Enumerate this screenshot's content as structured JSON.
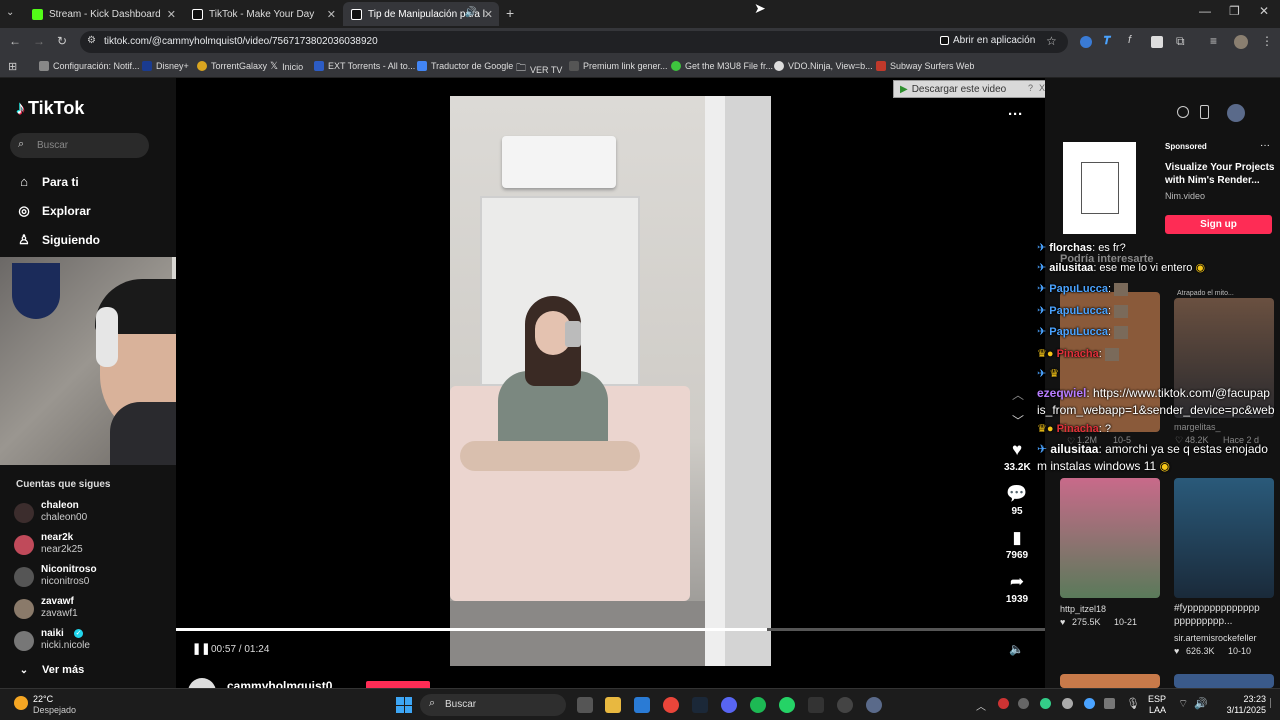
{
  "browser": {
    "tabs": [
      {
        "title": "Stream - Kick Dashboard",
        "active": false
      },
      {
        "title": "TikTok - Make Your Day",
        "active": false
      },
      {
        "title": "Tip de Manipulación para l",
        "active": true
      }
    ],
    "url": "tiktok.com/@cammyholmquist0/video/7567173802036038920",
    "open_in_app": "Abrir en aplicación",
    "bookmarks": [
      "Configuración: Notif...",
      "Disney+",
      "TorrentGalaxy",
      "Inicio",
      "EXT Torrents - All to...",
      "Traductor de Google",
      "VER TV",
      "Premium link gener...",
      "Get the M3U8 File fr...",
      "VDO.Ninja, View=b...",
      "Subway Surfers Web"
    ]
  },
  "download_bar": {
    "label": "Descargar este video",
    "help": "?",
    "close": "X"
  },
  "tiktok": {
    "logo": "TikTok",
    "search_placeholder": "Buscar",
    "nav": [
      "Para ti",
      "Explorar",
      "Siguiendo"
    ],
    "following_title": "Cuentas que sigues",
    "accounts": [
      {
        "name": "chaleon",
        "handle": "chaleon00"
      },
      {
        "name": "near2k",
        "handle": "near2k25"
      },
      {
        "name": "Niconitroso",
        "handle": "niconitros0"
      },
      {
        "name": "zavawf",
        "handle": "zavawf1"
      },
      {
        "name": "naiki",
        "handle": "nicki.nicole"
      }
    ],
    "see_more": "Ver más",
    "video": {
      "time": "00:57 / 01:24",
      "progress": 0.68,
      "author": "cammyholmquist0",
      "likes": "33.2K",
      "comments": "95",
      "saves": "7969",
      "shares": "1939"
    },
    "sponsored": {
      "label": "Sponsored",
      "title": "Visualize Your Projects with Nim's Render...",
      "domain": "Nim.video",
      "cta": "Sign up"
    },
    "might_like": "Podría interesarte",
    "related": [
      {
        "caption": "Atrapado el mito...",
        "user": "margelitas_",
        "views": "48.2K",
        "date": "Hace 2 d"
      },
      {
        "user": "",
        "views": "1.2M",
        "date": "10-5"
      },
      {
        "user": "http_itzel18",
        "views": "275.5K",
        "date": "10-21"
      },
      {
        "caption": "#fyppppppppppppp ppppppppp...",
        "user": "sir.artemisrockefeller",
        "views": "626.3K",
        "date": "10-10"
      }
    ]
  },
  "chat": [
    {
      "user": "florchas",
      "msg": ": es fr?",
      "color": "#ffffff"
    },
    {
      "user": "ailusitaa",
      "msg": ": ese me lo vi entero",
      "color": "#ffffff"
    },
    {
      "user": "PapuLucca",
      "msg": ":",
      "color": "#4aa3ff"
    },
    {
      "user": "PapuLucca",
      "msg": ":",
      "color": "#4aa3ff"
    },
    {
      "user": "PapuLucca",
      "msg": ":",
      "color": "#4aa3ff"
    },
    {
      "user": "Pinacha",
      "msg": ":",
      "color": "#e0303a"
    },
    {
      "user": "",
      "msg": "",
      "color": "#ffffff"
    },
    {
      "user": "ezeqwiel",
      "msg": ": https://www.tiktok.com/@facupap",
      "color": "#b77dff"
    },
    {
      "user": "",
      "msg": "is_from_webapp=1&sender_device=pc&web",
      "color": "#ffffff"
    },
    {
      "user": "Pinacha",
      "msg": ": ?",
      "color": "#e0303a"
    },
    {
      "user": "ailusitaa",
      "msg": ": amorchi ya se q estas enojado",
      "color": "#ffffff"
    },
    {
      "user": "",
      "msg": "m instalas windows 11",
      "color": "#ffffff"
    }
  ],
  "taskbar": {
    "weather_temp": "22°C",
    "weather_desc": "Despejado",
    "search": "Buscar",
    "lang1": "ESP",
    "lang2": "LAA",
    "time": "23:23",
    "date": "3/11/2025"
  }
}
